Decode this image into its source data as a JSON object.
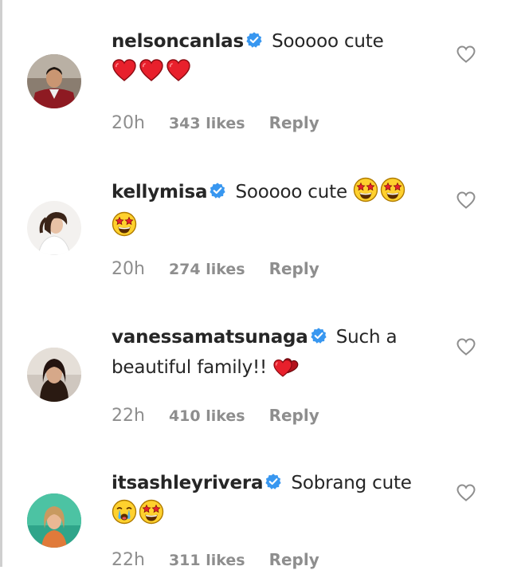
{
  "colors": {
    "text": "#262626",
    "muted": "#8e8e8e",
    "verified": "#3897f0",
    "heart": "#ed1c24"
  },
  "comments": [
    {
      "username": "nelsoncanlas",
      "verified": true,
      "text": "Sooooo cute",
      "emojis": [
        "red-heart",
        "red-heart",
        "red-heart"
      ],
      "time": "20h",
      "likes": "343 likes",
      "reply": "Reply"
    },
    {
      "username": "kellymisa",
      "verified": true,
      "text": "Sooooo cute",
      "emojis": [
        "star-struck",
        "star-struck",
        "star-struck"
      ],
      "time": "20h",
      "likes": "274 likes",
      "reply": "Reply"
    },
    {
      "username": "vanessamatsunaga",
      "verified": true,
      "text_line1": "Such a",
      "text_line2": "beautiful family!!",
      "emojis": [
        "hearts"
      ],
      "time": "22h",
      "likes": "410 likes",
      "reply": "Reply"
    },
    {
      "username": "itsashleyrivera",
      "verified": true,
      "text": "Sobrang cute",
      "emojis": [
        "crying-face",
        "star-struck"
      ],
      "time": "22h",
      "likes": "311 likes",
      "reply": "Reply"
    }
  ],
  "icons": {
    "like": "heart-outline-icon",
    "verified": "verified-badge-icon"
  }
}
